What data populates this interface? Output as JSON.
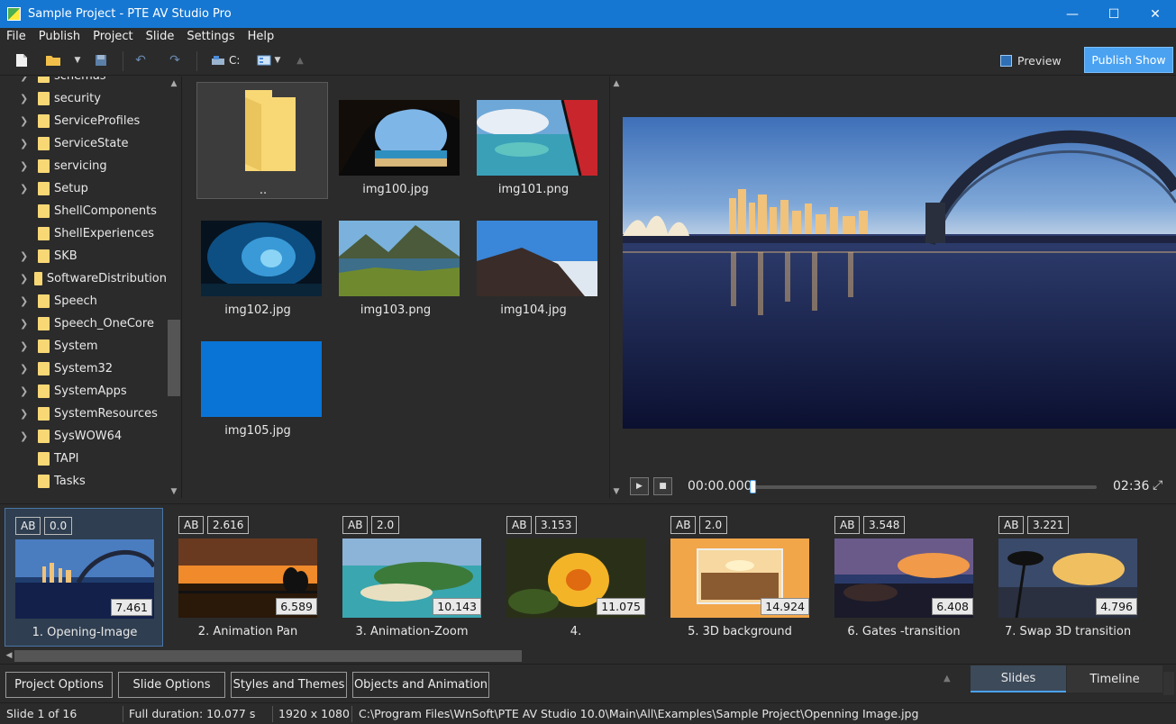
{
  "window": {
    "title": "Sample Project - PTE AV Studio Pro"
  },
  "menu": [
    "File",
    "Publish",
    "Project",
    "Slide",
    "Settings",
    "Help"
  ],
  "toolbar": {
    "drive": "C:",
    "preview_label": "Preview",
    "publish_label": "Publish Show"
  },
  "tree": {
    "items": [
      {
        "label": "schemas",
        "has_children": true
      },
      {
        "label": "security",
        "has_children": true
      },
      {
        "label": "ServiceProfiles",
        "has_children": true
      },
      {
        "label": "ServiceState",
        "has_children": true
      },
      {
        "label": "servicing",
        "has_children": true
      },
      {
        "label": "Setup",
        "has_children": true
      },
      {
        "label": "ShellComponents",
        "has_children": false
      },
      {
        "label": "ShellExperiences",
        "has_children": false
      },
      {
        "label": "SKB",
        "has_children": true
      },
      {
        "label": "SoftwareDistribution",
        "has_children": true
      },
      {
        "label": "Speech",
        "has_children": true
      },
      {
        "label": "Speech_OneCore",
        "has_children": true
      },
      {
        "label": "System",
        "has_children": true
      },
      {
        "label": "System32",
        "has_children": true
      },
      {
        "label": "SystemApps",
        "has_children": true
      },
      {
        "label": "SystemResources",
        "has_children": true
      },
      {
        "label": "SysWOW64",
        "has_children": true
      },
      {
        "label": "TAPI",
        "has_children": false
      },
      {
        "label": "Tasks",
        "has_children": false
      }
    ]
  },
  "files": [
    {
      "name": "..",
      "kind": "folder"
    },
    {
      "name": "img100.jpg",
      "kind": "image"
    },
    {
      "name": "img101.png",
      "kind": "image"
    },
    {
      "name": "img102.jpg",
      "kind": "image"
    },
    {
      "name": "img103.png",
      "kind": "image"
    },
    {
      "name": "img104.jpg",
      "kind": "image"
    },
    {
      "name": "img105.jpg",
      "kind": "image"
    }
  ],
  "player": {
    "time_current": "00:00.000",
    "time_total": "02:36",
    "progress": 0
  },
  "slides": [
    {
      "title": "1. Opening-Image",
      "ab": "AB",
      "transition": "0.0",
      "duration": "7.461"
    },
    {
      "title": "2. Animation Pan",
      "ab": "AB",
      "transition": "2.616",
      "duration": "6.589"
    },
    {
      "title": "3. Animation-Zoom",
      "ab": "AB",
      "transition": "2.0",
      "duration": "10.143"
    },
    {
      "title": "4.",
      "ab": "AB",
      "transition": "3.153",
      "duration": "11.075"
    },
    {
      "title": "5. 3D background",
      "ab": "AB",
      "transition": "2.0",
      "duration": "14.924"
    },
    {
      "title": "6. Gates -transition",
      "ab": "AB",
      "transition": "3.548",
      "duration": "6.408"
    },
    {
      "title": "7. Swap 3D transition",
      "ab": "AB",
      "transition": "3.221",
      "duration": "4.796"
    }
  ],
  "bottom_buttons": {
    "project_options": "Project Options",
    "slide_options": "Slide Options",
    "styles_themes": "Styles and Themes",
    "objects_animation": "Objects and Animation"
  },
  "modes": {
    "slides": "Slides",
    "timeline": "Timeline"
  },
  "status": {
    "slide": "Slide 1 of 16",
    "duration": "Full duration: 10.077 s",
    "resolution": "1920 x 1080",
    "path": "C:\\Program Files\\WnSoft\\PTE AV Studio 10.0\\Main\\All\\Examples\\Sample Project\\Openning Image.jpg"
  }
}
